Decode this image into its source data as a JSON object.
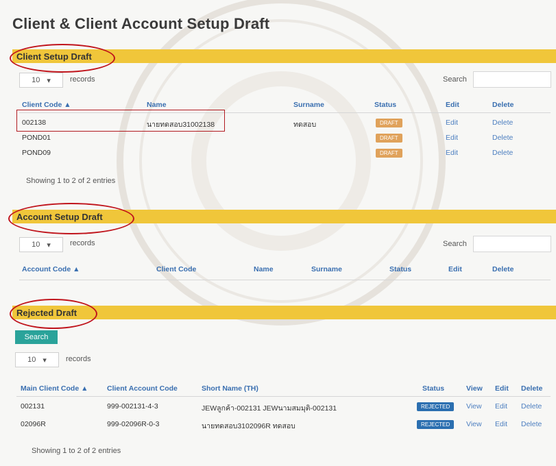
{
  "page": {
    "title": "Client & Client Account Setup Draft"
  },
  "client_setup": {
    "section_title": "Client Setup Draft",
    "length_value": "10",
    "length_label": "records",
    "search_label": "Search",
    "columns": [
      "Client Code ▲",
      "Name",
      "Surname",
      "Status",
      "Edit",
      "Delete"
    ],
    "rows": [
      {
        "code": "002138",
        "name": "นายทดสอบ31002138",
        "surname": "ทดสอบ",
        "status": "DRAFT",
        "edit": "Edit",
        "delete": "Delete"
      },
      {
        "code": "POND01",
        "name": "",
        "surname": "",
        "status": "DRAFT",
        "edit": "Edit",
        "delete": "Delete"
      },
      {
        "code": "POND09",
        "name": "",
        "surname": "",
        "status": "DRAFT",
        "edit": "Edit",
        "delete": "Delete"
      }
    ],
    "info": "Showing 1 to 2 of 2 entries"
  },
  "account_setup": {
    "section_title": "Account Setup Draft",
    "length_value": "10",
    "length_label": "records",
    "search_label": "Search",
    "columns": [
      "Account Code ▲",
      "Client Code",
      "Name",
      "Surname",
      "Status",
      "Edit",
      "Delete"
    ]
  },
  "rejected": {
    "section_title": "Rejected Draft",
    "search_button": "Search",
    "length_value": "10",
    "length_label": "records",
    "columns": [
      "Main Client Code ▲",
      "Client Account Code",
      "Short Name (TH)",
      "Status",
      "View",
      "Edit",
      "Delete"
    ],
    "rows": [
      {
        "main_code": "002131",
        "account_code": "999-002131-4-3",
        "short_name": "JEWลูกค้า-002131 JEWนามสมมุติ-002131",
        "status": "REJECTED",
        "view": "View",
        "edit": "Edit",
        "delete": "Delete"
      },
      {
        "main_code": "02096R",
        "account_code": "999-02096R-0-3",
        "short_name": "นายทดสอบ3102096R ทดสอบ",
        "status": "REJECTED",
        "view": "View",
        "edit": "Edit",
        "delete": "Delete"
      }
    ],
    "info": "Showing 1 to 2 of 2 entries"
  },
  "colors": {
    "section_bar": "#f0c63a",
    "link": "#4d7fc0",
    "draft_badge": "#e0a25b",
    "rejected_badge": "#2b6fb0",
    "search_button": "#2aa39a",
    "annotation_red": "#c0141c"
  }
}
